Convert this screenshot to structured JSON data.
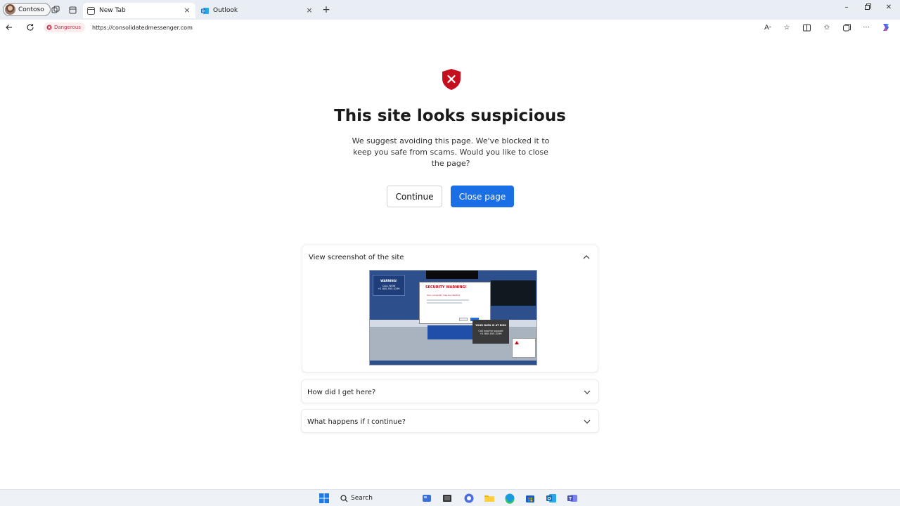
{
  "browser": {
    "profile_label": "Contoso",
    "tabs": [
      {
        "label": "New Tab",
        "active": true,
        "icon": "new-tab-icon"
      },
      {
        "label": "Outlook",
        "active": false,
        "icon": "outlook-icon"
      }
    ],
    "address": {
      "security_label": "Dangerous",
      "url": "https://consolidatedmessenger.com"
    }
  },
  "warning": {
    "title": "This site looks suspicious",
    "description": "We suggest avoiding this page. We've blocked it to keep you safe from scams. Would you like to close the page?",
    "continue_label": "Continue",
    "close_label": "Close page"
  },
  "sections": {
    "screenshot_title": "View screenshot of the site",
    "how_title": "How did I get here?",
    "what_title": "What happens if I continue?"
  },
  "thumbnail": {
    "warning_label": "WARNING!",
    "call_now": "CALL NOW",
    "phone": "+1 800-555-0199",
    "security_warning": "SECURITY WARNING!",
    "infected": "Your computer may be infected",
    "data_at_risk": "YOUR DATA IS AT RISK",
    "call_support": "Call now for support",
    "phone2": "+1 800-555-0199"
  },
  "taskbar": {
    "search_label": "Search"
  },
  "colors": {
    "danger": "#c4314b",
    "primary": "#1a6ee6",
    "shield": "#c50f1f"
  }
}
